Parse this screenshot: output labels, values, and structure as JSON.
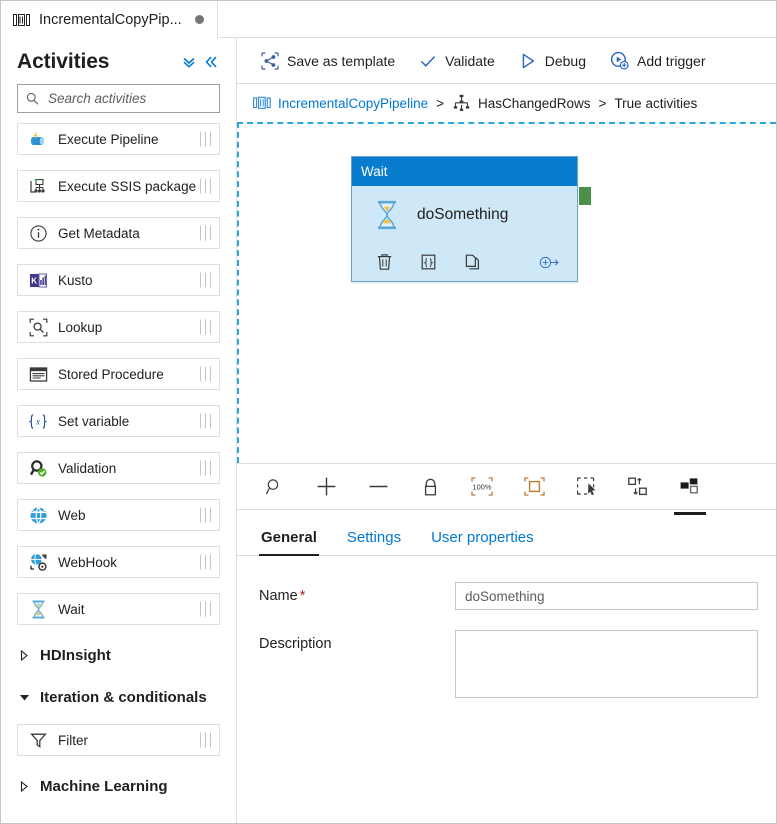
{
  "window": {
    "tab": {
      "title": "IncrementalCopyPip...",
      "icon": "pipeline-icon",
      "unsaved": true
    }
  },
  "sidebar": {
    "title": "Activities",
    "collapse_all_icon": "double-chevron-down-icon",
    "collapse_panel_icon": "double-chevron-left-icon",
    "search": {
      "placeholder": "Search activities",
      "value": "",
      "icon": "search-icon"
    },
    "activities": [
      {
        "label": "Execute Pipeline",
        "icon": "execute-pipeline-icon"
      },
      {
        "label": "Execute SSIS package",
        "icon": "execute-ssis-package-icon"
      },
      {
        "label": "Get Metadata",
        "icon": "get-metadata-icon"
      },
      {
        "label": "Kusto",
        "icon": "kusto-icon"
      },
      {
        "label": "Lookup",
        "icon": "lookup-icon"
      },
      {
        "label": "Stored Procedure",
        "icon": "stored-procedure-icon"
      },
      {
        "label": "Set variable",
        "icon": "set-variable-icon"
      },
      {
        "label": "Validation",
        "icon": "validation-icon"
      },
      {
        "label": "Web",
        "icon": "web-icon"
      },
      {
        "label": "WebHook",
        "icon": "webhook-icon"
      },
      {
        "label": "Wait",
        "icon": "wait-icon"
      }
    ],
    "categories": [
      {
        "label": "HDInsight",
        "expanded": false
      },
      {
        "label": "Iteration & conditionals",
        "expanded": true
      },
      {
        "label": "Machine Learning",
        "expanded": false
      }
    ],
    "iteration_activities": [
      {
        "label": "Filter",
        "icon": "filter-icon"
      }
    ]
  },
  "toolbar": {
    "save_as_template": "Save as template",
    "save_as_template_icon": "template-icon",
    "validate": "Validate",
    "validate_icon": "checkmark-icon",
    "debug": "Debug",
    "debug_icon": "play-triangle-icon",
    "add_trigger": "Add trigger",
    "add_trigger_icon": "trigger-add-icon"
  },
  "breadcrumb": {
    "pipeline_icon": "pipeline-icon",
    "pipeline": "IncrementalCopyPipeline",
    "sep1": ">",
    "condition_icon": "if-condition-icon",
    "condition": "HasChangedRows",
    "sep2": ">",
    "current": "True activities"
  },
  "canvas": {
    "node": {
      "type": "Wait",
      "name": "doSomething",
      "type_icon": "hourglass-icon",
      "actions": [
        {
          "name": "delete-activity",
          "icon": "trash-icon"
        },
        {
          "name": "view-code",
          "icon": "code-braces-icon"
        },
        {
          "name": "clone-activity",
          "icon": "copy-icon"
        },
        {
          "name": "add-output-connection",
          "icon": "add-arrow-icon"
        }
      ],
      "output_port": "success-output-port"
    },
    "accent_color": "#0a7cce",
    "body_color": "#cfe8f7",
    "port_color": "#4a8f4a",
    "dropzone_border_color": "#29a8e0"
  },
  "canvas_toolbar": [
    {
      "name": "zoom-search",
      "icon": "magnifier-icon",
      "active": false
    },
    {
      "name": "zoom-in",
      "icon": "plus-icon",
      "active": false
    },
    {
      "name": "zoom-out",
      "icon": "minus-icon",
      "active": false
    },
    {
      "name": "lock-canvas",
      "icon": "lock-icon",
      "active": false
    },
    {
      "name": "zoom-to-100",
      "icon": "zoom-100-percent-icon",
      "label": "100%",
      "active": false
    },
    {
      "name": "zoom-to-fit",
      "icon": "fit-to-screen-icon",
      "active": false
    },
    {
      "name": "select-mode",
      "icon": "marquee-select-icon",
      "active": false
    },
    {
      "name": "auto-align",
      "icon": "auto-align-icon",
      "active": false
    },
    {
      "name": "toggle-properties",
      "icon": "properties-panel-icon",
      "active": true
    }
  ],
  "properties": {
    "tabs": [
      {
        "label": "General",
        "active": true
      },
      {
        "label": "Settings",
        "active": false
      },
      {
        "label": "User properties",
        "active": false
      }
    ],
    "fields": {
      "name_label": "Name",
      "name_required": "*",
      "name_value": "doSomething",
      "description_label": "Description",
      "description_value": ""
    }
  }
}
